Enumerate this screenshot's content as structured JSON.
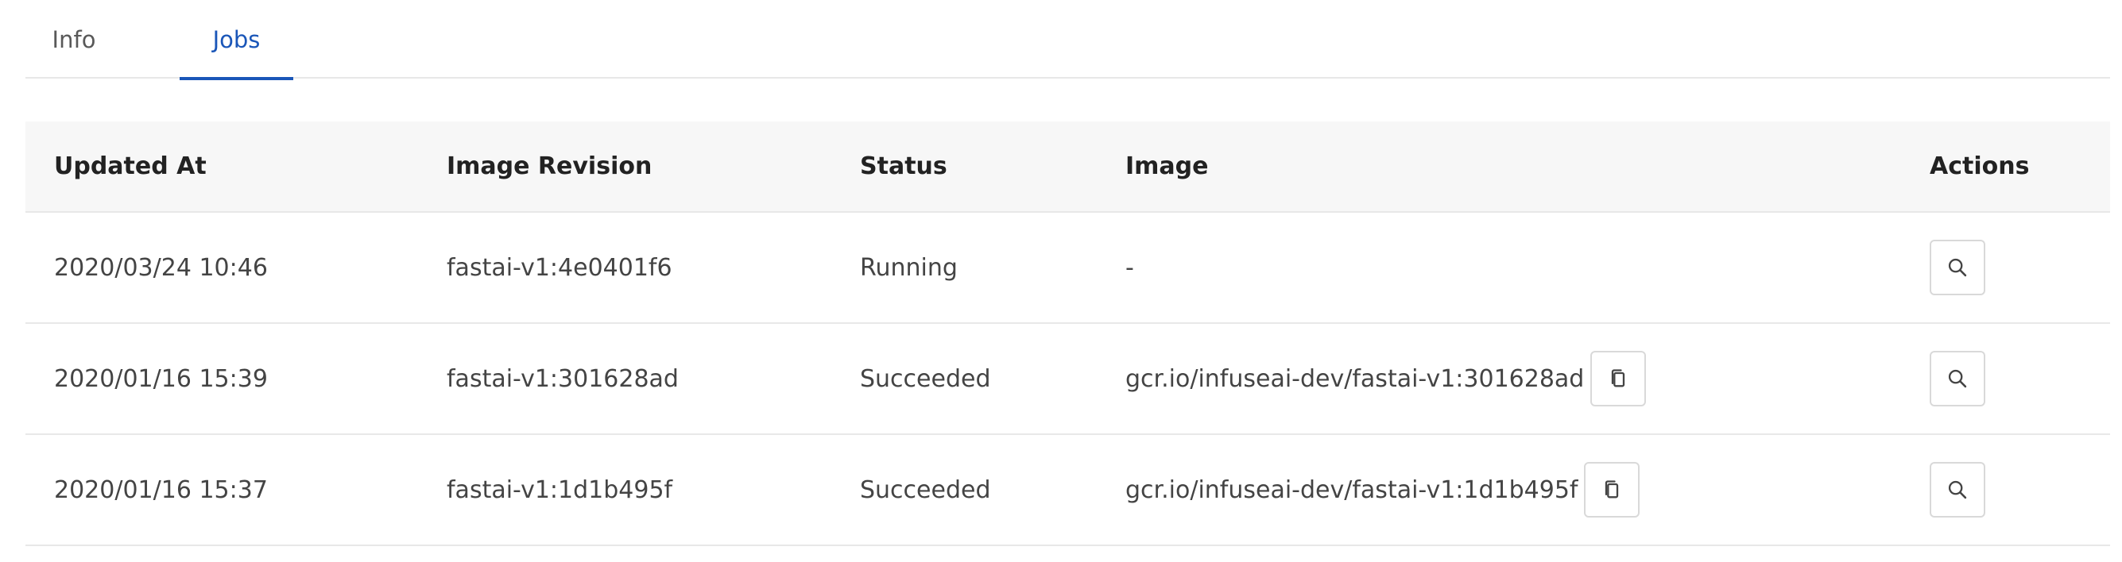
{
  "tabs": [
    {
      "label": "Info",
      "active": false
    },
    {
      "label": "Jobs",
      "active": true
    }
  ],
  "colors": {
    "accent": "#1a56b8",
    "header_bg": "#f7f7f7",
    "border": "#e8e8e8"
  },
  "table": {
    "headers": {
      "updated_at": "Updated At",
      "image_revision": "Image Revision",
      "status": "Status",
      "image": "Image",
      "actions": "Actions"
    },
    "rows": [
      {
        "updated_at": "2020/03/24 10:46",
        "image_revision": "fastai-v1:4e0401f6",
        "status": "Running",
        "image": "-",
        "has_copy": false,
        "action_icon": "search-icon"
      },
      {
        "updated_at": "2020/01/16 15:39",
        "image_revision": "fastai-v1:301628ad",
        "status": "Succeeded",
        "image": "gcr.io/infuseai-dev/fastai-v1:301628ad",
        "has_copy": true,
        "copy_icon": "copy-icon",
        "action_icon": "search-icon"
      },
      {
        "updated_at": "2020/01/16 15:37",
        "image_revision": "fastai-v1:1d1b495f",
        "status": "Succeeded",
        "image": "gcr.io/infuseai-dev/fastai-v1:1d1b495f",
        "has_copy": true,
        "copy_icon": "copy-icon",
        "action_icon": "search-icon"
      }
    ]
  }
}
